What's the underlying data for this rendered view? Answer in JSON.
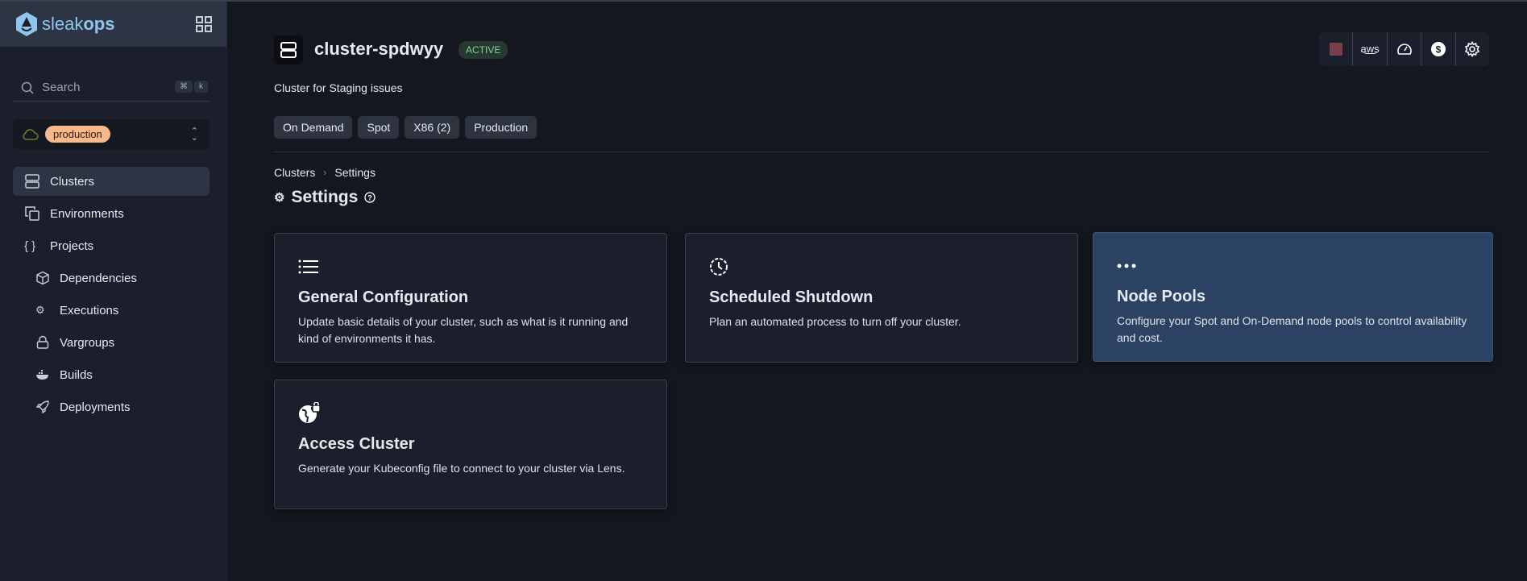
{
  "sidebar": {
    "logo": {
      "light": "sleak",
      "bold": "ops"
    },
    "search": {
      "placeholder": "Search",
      "shortcut": [
        "⌘",
        "k"
      ]
    },
    "environment": {
      "selected": "production",
      "badge_color": "#f9b98a"
    },
    "items": [
      {
        "label": "Clusters",
        "icon": "server-icon",
        "active": true
      },
      {
        "label": "Environments",
        "icon": "copy-icon"
      },
      {
        "label": "Projects",
        "icon": "braces-icon"
      },
      {
        "label": "Dependencies",
        "icon": "cube-icon"
      },
      {
        "label": "Executions",
        "icon": "cogs-icon"
      },
      {
        "label": "Vargroups",
        "icon": "lock-icon"
      },
      {
        "label": "Builds",
        "icon": "docker-icon"
      },
      {
        "label": "Deployments",
        "icon": "rocket-icon"
      }
    ]
  },
  "header": {
    "title": "cluster-spdwyy",
    "status": "ACTIVE",
    "description": "Cluster for Staging issues",
    "tags": [
      "On Demand",
      "Spot",
      "X86 (2)",
      "Production"
    ],
    "toolbar": {
      "aws_label": "aws",
      "color_swatch": "#7a3e48"
    }
  },
  "breadcrumb": [
    "Clusters",
    "Settings"
  ],
  "page_title": "Settings",
  "cards": [
    {
      "title": "General Configuration",
      "description": "Update basic details of your cluster, such as what is it running and kind of environments it has.",
      "icon": "list-icon"
    },
    {
      "title": "Scheduled Shutdown",
      "description": "Plan an automated process to turn off your cluster.",
      "icon": "clock-icon"
    },
    {
      "title": "Node Pools",
      "description": "Configure your Spot and On-Demand node pools to control availability and cost.",
      "icon": "more-icon",
      "highlighted": true
    },
    {
      "title": "Access Cluster",
      "description": "Generate your Kubeconfig file to connect to your cluster via Lens.",
      "icon": "globe-lock-icon"
    }
  ]
}
